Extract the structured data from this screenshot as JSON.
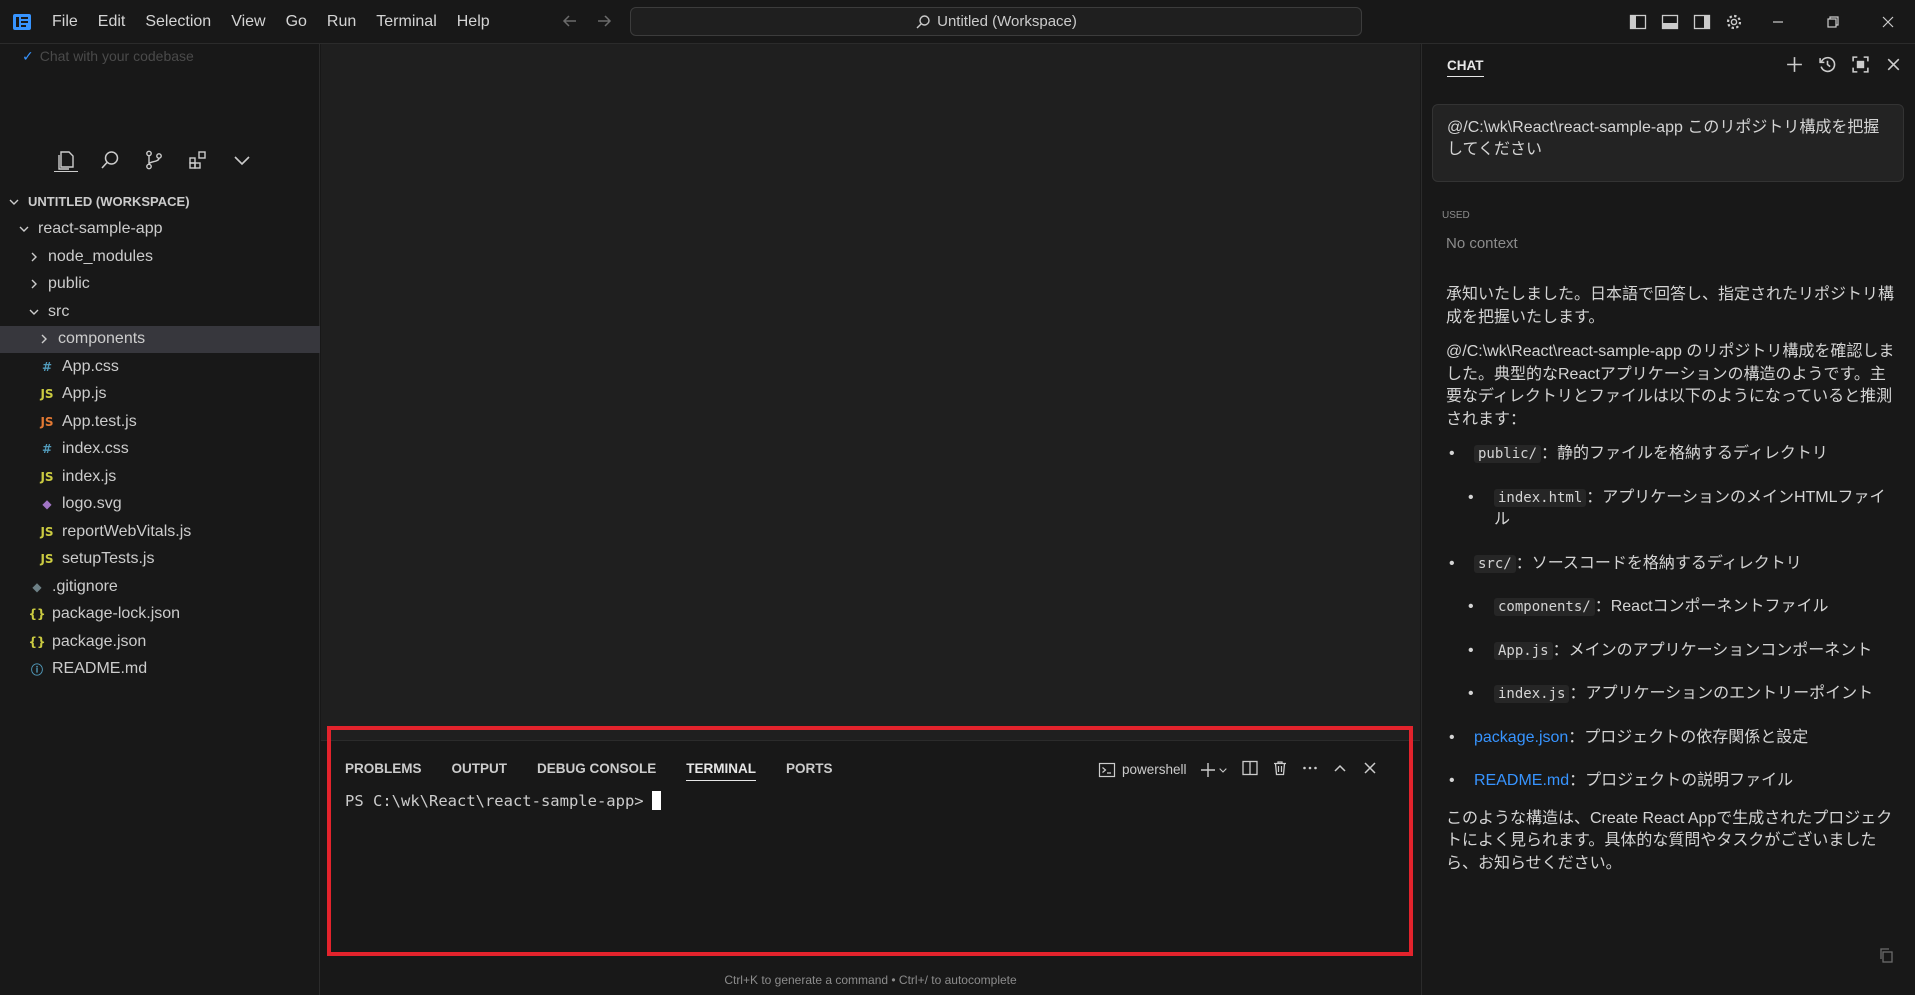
{
  "menu": [
    "File",
    "Edit",
    "Selection",
    "View",
    "Go",
    "Run",
    "Terminal",
    "Help"
  ],
  "command_center": "Untitled (Workspace)",
  "sidebar": {
    "chat_stub": "Chat with your codebase",
    "tree": [
      {
        "label": "UNTITLED (WORKSPACE)",
        "indent": 0,
        "kind": "root",
        "expanded": true
      },
      {
        "label": "react-sample-app",
        "indent": 1,
        "kind": "folder",
        "expanded": true
      },
      {
        "label": "node_modules",
        "indent": 2,
        "kind": "folder",
        "expanded": false
      },
      {
        "label": "public",
        "indent": 2,
        "kind": "folder",
        "expanded": false
      },
      {
        "label": "src",
        "indent": 2,
        "kind": "folder",
        "expanded": true
      },
      {
        "label": "components",
        "indent": 3,
        "kind": "folder",
        "expanded": false,
        "selected": true
      },
      {
        "label": "App.css",
        "indent": 3,
        "kind": "css"
      },
      {
        "label": "App.js",
        "indent": 3,
        "kind": "js"
      },
      {
        "label": "App.test.js",
        "indent": 3,
        "kind": "test"
      },
      {
        "label": "index.css",
        "indent": 3,
        "kind": "css"
      },
      {
        "label": "index.js",
        "indent": 3,
        "kind": "js"
      },
      {
        "label": "logo.svg",
        "indent": 3,
        "kind": "svg"
      },
      {
        "label": "reportWebVitals.js",
        "indent": 3,
        "kind": "js"
      },
      {
        "label": "setupTests.js",
        "indent": 3,
        "kind": "js"
      },
      {
        "label": ".gitignore",
        "indent": 2,
        "kind": "git"
      },
      {
        "label": "package-lock.json",
        "indent": 2,
        "kind": "json"
      },
      {
        "label": "package.json",
        "indent": 2,
        "kind": "json"
      },
      {
        "label": "README.md",
        "indent": 2,
        "kind": "info"
      }
    ]
  },
  "panel": {
    "tabs": [
      "PROBLEMS",
      "OUTPUT",
      "DEBUG CONSOLE",
      "TERMINAL",
      "PORTS"
    ],
    "active_tab": "TERMINAL",
    "shell": "powershell",
    "prompt": "PS C:\\wk\\React\\react-sample-app>",
    "hint": "Ctrl+K to generate a command • Ctrl+/ to autocomplete"
  },
  "chat": {
    "title": "CHAT",
    "user_prompt": "@/C:\\wk\\React\\react-sample-app このリポジトリ構成を把握してください",
    "used_label": "USED",
    "context": "No context",
    "intro1": "承知いたしました。日本語で回答し、指定されたリポジトリ構成を把握いたします。",
    "intro2": "@/C:\\wk\\React\\react-sample-app のリポジトリ構成を確認しました。典型的なReactアプリケーションの構造のようです。主要なディレクトリとファイルは以下のようになっていると推測されます：",
    "items": [
      {
        "code": "public/",
        "text": "：静的ファイルを格納するディレクトリ",
        "level": 0
      },
      {
        "code": "index.html",
        "text": "：アプリケーションのメインHTMLファイル",
        "level": 1
      },
      {
        "code": "src/",
        "text": "：ソースコードを格納するディレクトリ",
        "level": 0
      },
      {
        "code": "components/",
        "text": "：Reactコンポーネントファイル",
        "level": 1
      },
      {
        "code": "App.js",
        "text": "：メインのアプリケーションコンポーネント",
        "level": 1
      },
      {
        "code": "index.js",
        "text": "：アプリケーションのエントリーポイント",
        "level": 1
      },
      {
        "link": "package.json",
        "text": "：プロジェクトの依存関係と設定",
        "level": 0
      },
      {
        "link": "README.md",
        "text": "：プロジェクトの説明ファイル",
        "level": 0
      }
    ],
    "outro": "このような構造は、Create React Appで生成されたプロジェクトによく見られます。具体的な質問やタスクがございましたら、お知らせください。"
  },
  "colors": {
    "accent": "#3794ff",
    "highlight": "#e3232c",
    "js": "#cbcb41",
    "css": "#519aba",
    "test": "#e37933",
    "json": "#cbcb41",
    "svg": "#a074c4",
    "git": "#6d8086",
    "info": "#519aba"
  }
}
